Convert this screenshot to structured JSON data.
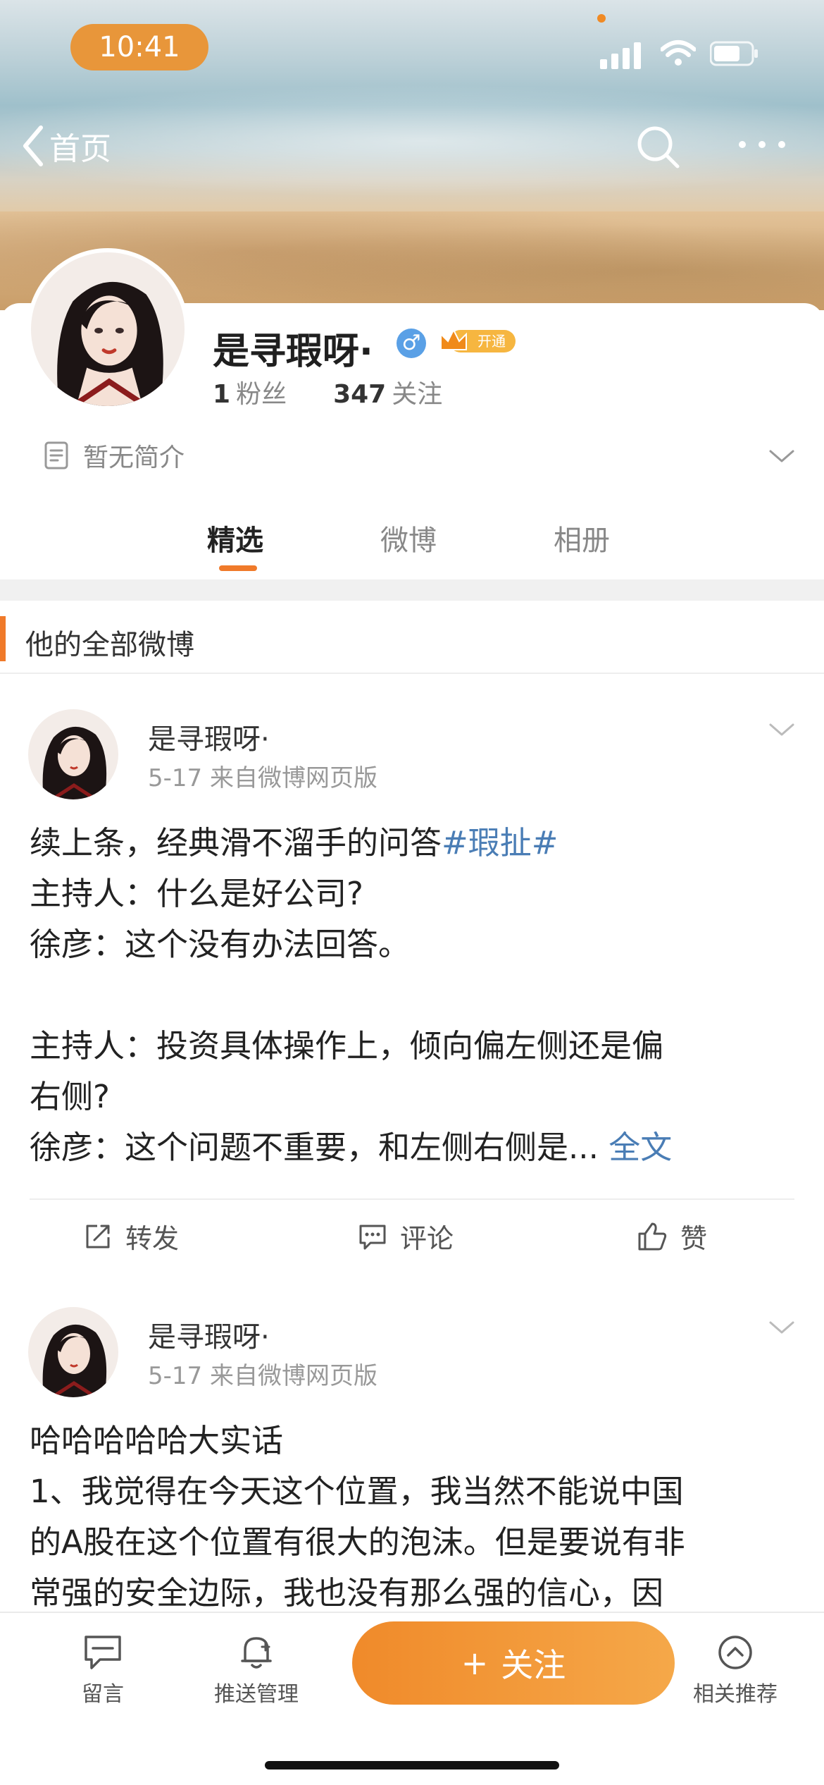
{
  "status_bar": {
    "time": "10:41"
  },
  "nav": {
    "back_label": "首页"
  },
  "profile": {
    "name": "是寻瑕呀·",
    "gender_symbol": "♂",
    "vip_label": "开通",
    "followers_count": "1",
    "followers_label": "粉丝",
    "following_count": "347",
    "following_label": "关注",
    "bio": "暂无简介"
  },
  "tabs": [
    {
      "label": "精选"
    },
    {
      "label": "微博"
    },
    {
      "label": "相册"
    }
  ],
  "section_title": "他的全部微博",
  "posts": [
    {
      "author": "是寻瑕呀·",
      "meta": "5-17  来自微博网页版",
      "lines": [
        "续上条，经典滑不溜手的问答",
        "主持人：什么是好公司?",
        "徐彦：这个没有办法回答。",
        "主持人：投资具体操作上，倾向偏左侧还是偏",
        "右侧?",
        "徐彦：这个问题不重要，和左侧右侧是..."
      ],
      "hashtag": "#瑕扯#",
      "fulltext_label": "全文",
      "actions": {
        "repost": "转发",
        "comment": "评论",
        "like": "赞"
      }
    },
    {
      "author": "是寻瑕呀·",
      "meta": "5-17  来自微博网页版",
      "lines": [
        "哈哈哈哈哈大实话",
        "1、我觉得在今天这个位置，我当然不能说中国",
        "的A股在这个位置有很大的泡沫。但是要说有非",
        "常强的安全边际，我也没有那么强的信心，因"
      ]
    }
  ],
  "bottom_bar": {
    "message_label": "留言",
    "push_label": "推送管理",
    "follow_label": "关注",
    "follow_plus": "+",
    "recommend_label": "相关推荐"
  },
  "colors": {
    "accent": "#f07a2a",
    "link": "#4a7db5",
    "time_pill": "#e8963a"
  }
}
